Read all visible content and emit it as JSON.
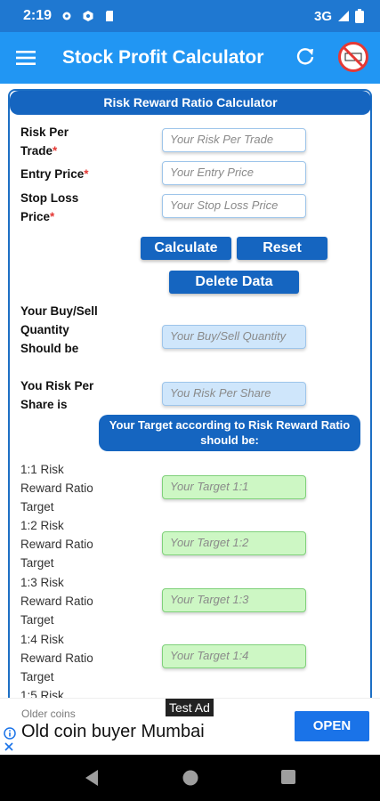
{
  "status_bar": {
    "time": "2:19",
    "network": "3G"
  },
  "app_bar": {
    "title": "Stock Profit Calculator"
  },
  "section_header": "Risk Reward Ratio Calculator",
  "inputs": {
    "risk_per_trade": {
      "label": "Risk Per Trade",
      "placeholder": "Your Risk Per Trade"
    },
    "entry_price": {
      "label": "Entry Price",
      "placeholder": "Your Entry Price"
    },
    "stop_loss": {
      "label": "Stop Loss Price",
      "placeholder": "Your Stop Loss Price"
    },
    "required_mark": "*"
  },
  "buttons": {
    "calculate": "Calculate",
    "reset": "Reset",
    "delete": "Delete Data"
  },
  "outputs": {
    "quantity": {
      "label": "Your Buy/Sell Quantity Should be",
      "placeholder": "Your Buy/Sell Quantity"
    },
    "risk_per_share": {
      "label": "You Risk Per Share is",
      "placeholder": "You Risk Per Share"
    }
  },
  "targets_header": "Your Target according to Risk Reward Ratio should be:",
  "targets": [
    {
      "label": "1:1 Risk Reward Ratio Target",
      "placeholder": "Your Target 1:1"
    },
    {
      "label": "1:2 Risk Reward Ratio Target",
      "placeholder": "Your Target 1:2"
    },
    {
      "label": "1:3 Risk Reward Ratio Target",
      "placeholder": "Your Target 1:3"
    },
    {
      "label": "1:4 Risk Reward Ratio Target",
      "placeholder": "Your Target 1:4"
    },
    {
      "label": "1:5 Risk"
    }
  ],
  "ad": {
    "tag": "Test Ad",
    "subtitle": "Older coins",
    "headline": "Old coin buyer Mumbai",
    "cta": "OPEN"
  },
  "colors": {
    "primary": "#2196f3",
    "dark_blue": "#1565c0",
    "required": "#e53935",
    "target_green": "#cdf7c4",
    "output_blue": "#cfe6fb"
  }
}
